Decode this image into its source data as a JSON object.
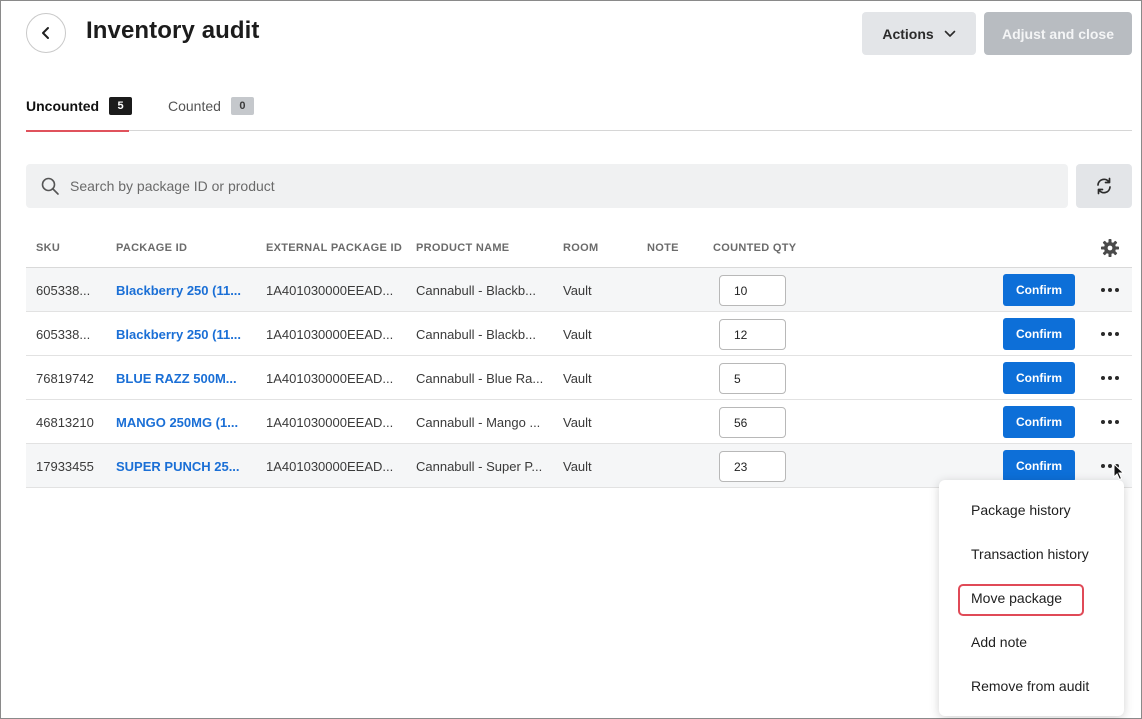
{
  "header": {
    "title": "Inventory audit",
    "actions_label": "Actions",
    "adjust_label": "Adjust and close"
  },
  "tabs": [
    {
      "label": "Uncounted",
      "count": "5"
    },
    {
      "label": "Counted",
      "count": "0"
    }
  ],
  "search": {
    "placeholder": "Search by package ID or product"
  },
  "table": {
    "columns": [
      "SKU",
      "PACKAGE ID",
      "EXTERNAL PACKAGE ID",
      "PRODUCT NAME",
      "ROOM",
      "NOTE",
      "COUNTED QTY"
    ],
    "confirm_label": "Confirm",
    "rows": [
      {
        "sku": "605338...",
        "package_id": "Blackberry 250 (11...",
        "external_id": "1A401030000EEAD...",
        "product": "Cannabull - Blackb...",
        "room": "Vault",
        "note": "",
        "qty": "10"
      },
      {
        "sku": "605338...",
        "package_id": "Blackberry 250 (11...",
        "external_id": "1A401030000EEAD...",
        "product": "Cannabull - Blackb...",
        "room": "Vault",
        "note": "",
        "qty": "12"
      },
      {
        "sku": "76819742",
        "package_id": "BLUE RAZZ 500M...",
        "external_id": "1A401030000EEAD...",
        "product": "Cannabull - Blue Ra...",
        "room": "Vault",
        "note": "",
        "qty": "5"
      },
      {
        "sku": "46813210",
        "package_id": "MANGO 250MG (1...",
        "external_id": "1A401030000EEAD...",
        "product": "Cannabull - Mango ...",
        "room": "Vault",
        "note": "",
        "qty": "56"
      },
      {
        "sku": "17933455",
        "package_id": "SUPER PUNCH 25...",
        "external_id": "1A401030000EEAD...",
        "product": "Cannabull - Super P...",
        "room": "Vault",
        "note": "",
        "qty": "23"
      }
    ]
  },
  "menu": {
    "items": [
      "Package history",
      "Transaction history",
      "Move package",
      "Add note",
      "Remove from audit"
    ],
    "highlighted": "Move package"
  },
  "colors": {
    "accent": "#0d6fd8",
    "tab_underline": "#e0525c",
    "highlight_border": "#e04a57",
    "link": "#1a6fd6"
  }
}
